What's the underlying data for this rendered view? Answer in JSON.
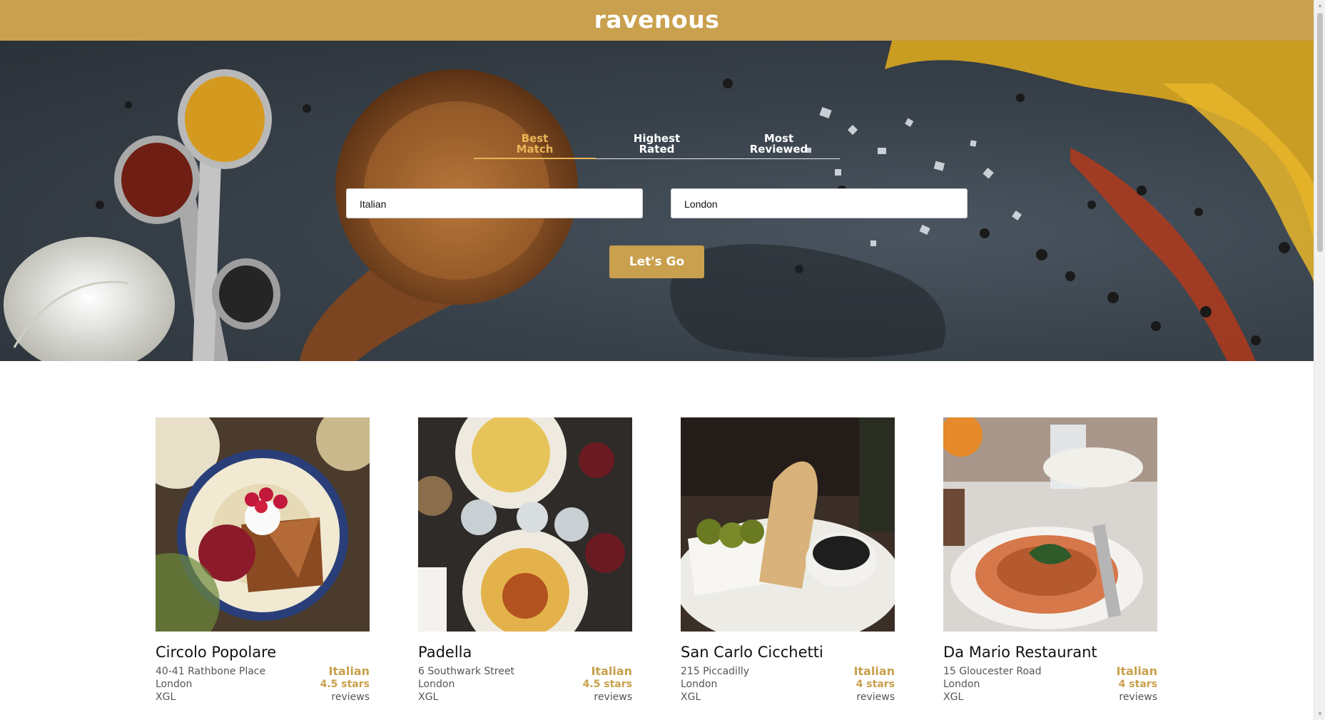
{
  "header": {
    "logo": "ravenous"
  },
  "search": {
    "sort_options": [
      {
        "label": "Best\nMatch",
        "line1": "Best",
        "line2": "Match",
        "active": true
      },
      {
        "label": "Highest\nRated",
        "line1": "Highest",
        "line2": "Rated",
        "active": false
      },
      {
        "label": "Most\nReviewed",
        "line1": "Most",
        "line2": "Reviewed",
        "active": false
      }
    ],
    "term_value": "Italian",
    "location_value": "London",
    "submit_label": "Let's Go"
  },
  "businesses": [
    {
      "name": "Circolo Popolare",
      "address": "40-41 Rathbone Place",
      "city": "London",
      "code": "XGL",
      "category": "Italian",
      "rating": "4.5 stars",
      "reviews": "reviews"
    },
    {
      "name": "Padella",
      "address": "6 Southwark Street",
      "city": "London",
      "code": "XGL",
      "category": "Italian",
      "rating": "4.5 stars",
      "reviews": "reviews"
    },
    {
      "name": "San Carlo Cicchetti",
      "address": "215 Piccadilly",
      "city": "London",
      "code": "XGL",
      "category": "Italian",
      "rating": "4 stars",
      "reviews": "reviews"
    },
    {
      "name": "Da Mario Restaurant",
      "address": "15 Gloucester Road",
      "city": "London",
      "code": "XGL",
      "category": "Italian",
      "rating": "4 stars",
      "reviews": "reviews"
    }
  ],
  "colors": {
    "brand": "#c9a04d",
    "active_tab": "#e9b556"
  }
}
